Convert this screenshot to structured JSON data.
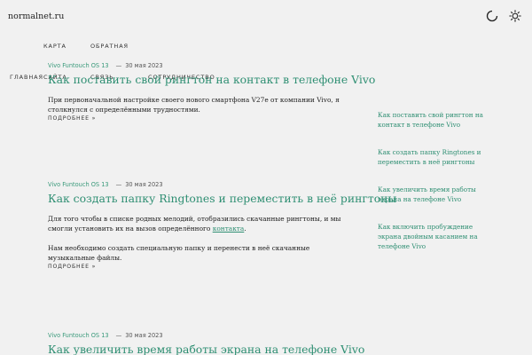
{
  "header": {
    "site_name": "normalnet.ru",
    "icons": [
      "loader-icon",
      "sun-icon"
    ]
  },
  "nav": {
    "items": [
      "Карта",
      "Обратная",
      "Главная",
      "сайта",
      "связь",
      "Сотрудничество"
    ]
  },
  "posts": [
    {
      "category": "Vivo Funtouch OS 13",
      "date": "30 мая 2023",
      "title": "Как поставить свой рингтон на контакт в телефоне Vivo",
      "paragraphs": [
        "При первоначальной настройке своего нового смартфона V27e от компании Vivo, я столкнулся с определёнными трудностями."
      ],
      "read_more": "Подробнее »"
    },
    {
      "category": "Vivo Funtouch OS 13",
      "date": "30 мая 2023",
      "title": "Как создать папку Ringtones и переместить в неё рингтоны",
      "paragraph1_before": "Для того чтобы в списке родных мелодий, отобразились скачанные рингтоны, и мы смогли установить их на вызов определённого ",
      "paragraph1_link": "контакта",
      "paragraph1_after": ".",
      "paragraph2": "Нам необходимо создать специальную папку и перенести в неё скачанные музыкальные файлы.",
      "read_more": "Подробнее »"
    },
    {
      "category": "Vivo Funtouch OS 13",
      "date": "30 мая 2023",
      "title": "Как увеличить время работы экрана на телефоне Vivo"
    }
  ],
  "sidebar": {
    "links": [
      "Как поставить свой рингтон на контакт в телефоне Vivo",
      "Как создать папку Ringtones и переместить в неё рингтоны",
      "Как увеличить время работы экрана на телефоне Vivo",
      "Как включить пробуждение экрана двойным касанием на телефоне Vivo"
    ]
  },
  "colors": {
    "accent": "#2f8f73",
    "background": "#f1f1f1",
    "text": "#222222"
  }
}
